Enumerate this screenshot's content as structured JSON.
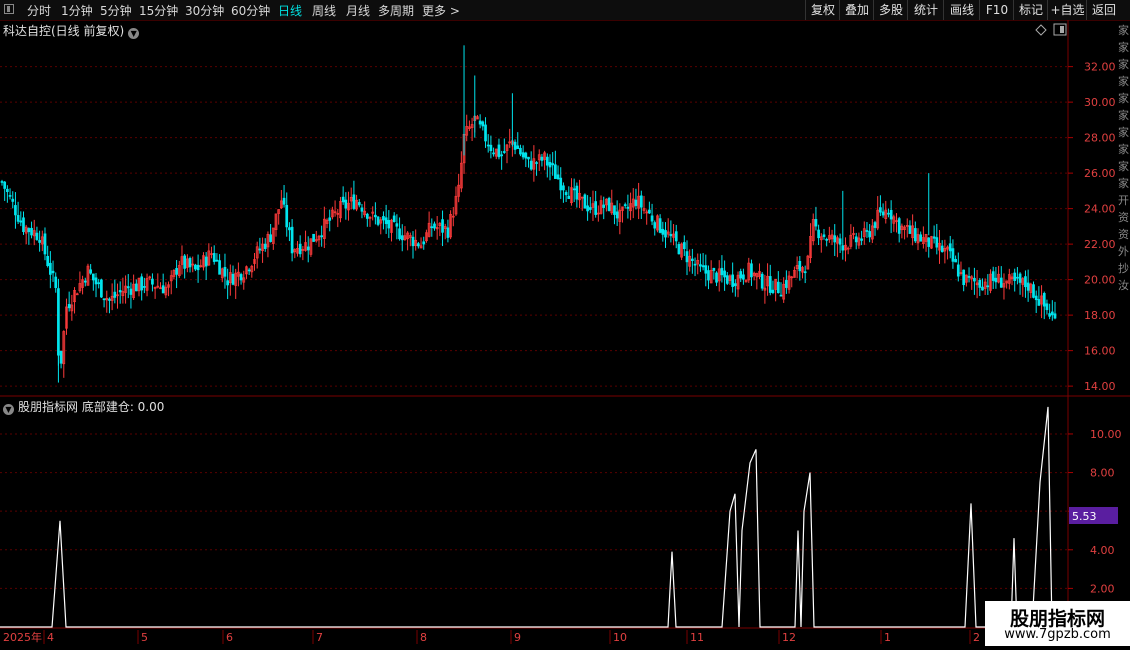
{
  "toolbar": {
    "periods": [
      "分时",
      "1分钟",
      "5分钟",
      "15分钟",
      "30分钟",
      "60分钟",
      "日线",
      "周线",
      "月线",
      "多周期",
      "更多 >"
    ],
    "active_period": "日线",
    "right_buttons": [
      "复权",
      "叠加",
      "多股",
      "统计",
      "画线",
      "F10",
      "标记",
      "+自选",
      "返回"
    ]
  },
  "main_chart": {
    "title": "科达自控(日线 前复权)",
    "y_ticks": [
      "32.00",
      "30.00",
      "28.00",
      "26.00",
      "24.00",
      "22.00",
      "20.00",
      "18.00",
      "16.00",
      "14.00"
    ]
  },
  "indicator": {
    "title": "股朋指标网  底部建仓: 0.00",
    "y_ticks": [
      "10.00",
      "8.00",
      "6.00",
      "4.00",
      "2.00"
    ],
    "current_value": "5.53"
  },
  "x_axis": {
    "labels": [
      "2025年",
      "4",
      "5",
      "6",
      "7",
      "8",
      "9",
      "10",
      "11",
      "12",
      "1",
      "2"
    ]
  },
  "watermark": {
    "line1": "股朋指标网",
    "line2": "www.7gpzb.com"
  },
  "side_partial": [
    "家",
    "家",
    "家",
    "家",
    "家",
    "家",
    "家",
    "家",
    "家",
    "家",
    "开",
    "资",
    "资",
    "外",
    "抄",
    "汝"
  ],
  "colors": {
    "up": "#ff3b3b",
    "down": "#00e5ee",
    "grid": "#5a0000",
    "indicator_line": "#ffffff",
    "value_tag": "#5a1ea0"
  },
  "chart_data": [
    {
      "type": "candlestick",
      "title": "科达自控(日线 前复权)",
      "ylim": [
        13.5,
        33.5
      ],
      "series": [
        {
          "date": "2025-03",
          "close": 25.5
        },
        {
          "date": "2025-03",
          "close": 22.0
        },
        {
          "date": "2025-03",
          "close": 23.5
        },
        {
          "date": "2025-04",
          "close": 20.0
        },
        {
          "date": "2025-04",
          "close": 16.5
        },
        {
          "date": "2025-04",
          "close": 19.0
        },
        {
          "date": "2025-05",
          "close": 20.5
        },
        {
          "date": "2025-05",
          "close": 19.5
        },
        {
          "date": "2025-05",
          "close": 18.0
        },
        {
          "date": "2025-06",
          "close": 20.0
        },
        {
          "date": "2025-06",
          "close": 21.0
        },
        {
          "date": "2025-06",
          "close": 20.0
        },
        {
          "date": "2025-07",
          "close": 24.0
        },
        {
          "date": "2025-07",
          "close": 22.0
        },
        {
          "date": "2025-07",
          "close": 24.0
        },
        {
          "date": "2025-08",
          "close": 24.0
        },
        {
          "date": "2025-08",
          "close": 22.5
        },
        {
          "date": "2025-08",
          "close": 23.0
        },
        {
          "date": "2025-09",
          "close": 30.0
        },
        {
          "date": "2025-09",
          "close": 28.5
        },
        {
          "date": "2025-09",
          "close": 27.0
        },
        {
          "date": "2025-10",
          "close": 26.5
        },
        {
          "date": "2025-10",
          "close": 24.0
        },
        {
          "date": "2025-10",
          "close": 25.0
        },
        {
          "date": "2025-11",
          "close": 23.0
        },
        {
          "date": "2025-11",
          "close": 21.0
        },
        {
          "date": "2025-11",
          "close": 20.0
        },
        {
          "date": "2025-12",
          "close": 21.0
        },
        {
          "date": "2025-12",
          "close": 22.5
        },
        {
          "date": "2025-12",
          "close": 22.0
        },
        {
          "date": "2026-01",
          "close": 23.5
        },
        {
          "date": "2026-01",
          "close": 22.0
        },
        {
          "date": "2026-01",
          "close": 20.0
        },
        {
          "date": "2026-02",
          "close": 19.5
        },
        {
          "date": "2026-02",
          "close": 17.6
        }
      ]
    },
    {
      "type": "line",
      "title": "底部建仓",
      "ylim": [
        0,
        11.5
      ],
      "series": [
        {
          "name": "底部建仓",
          "x": [
            "2025-04",
            "2025-10",
            "2025-11",
            "2025-11",
            "2025-11",
            "2025-12",
            "2025-12",
            "2026-01",
            "2026-02",
            "2026-02"
          ],
          "y": [
            5.5,
            3.9,
            6.9,
            9.2,
            5.0,
            8.0,
            4.8,
            6.4,
            4.6,
            11.4
          ]
        }
      ]
    }
  ]
}
